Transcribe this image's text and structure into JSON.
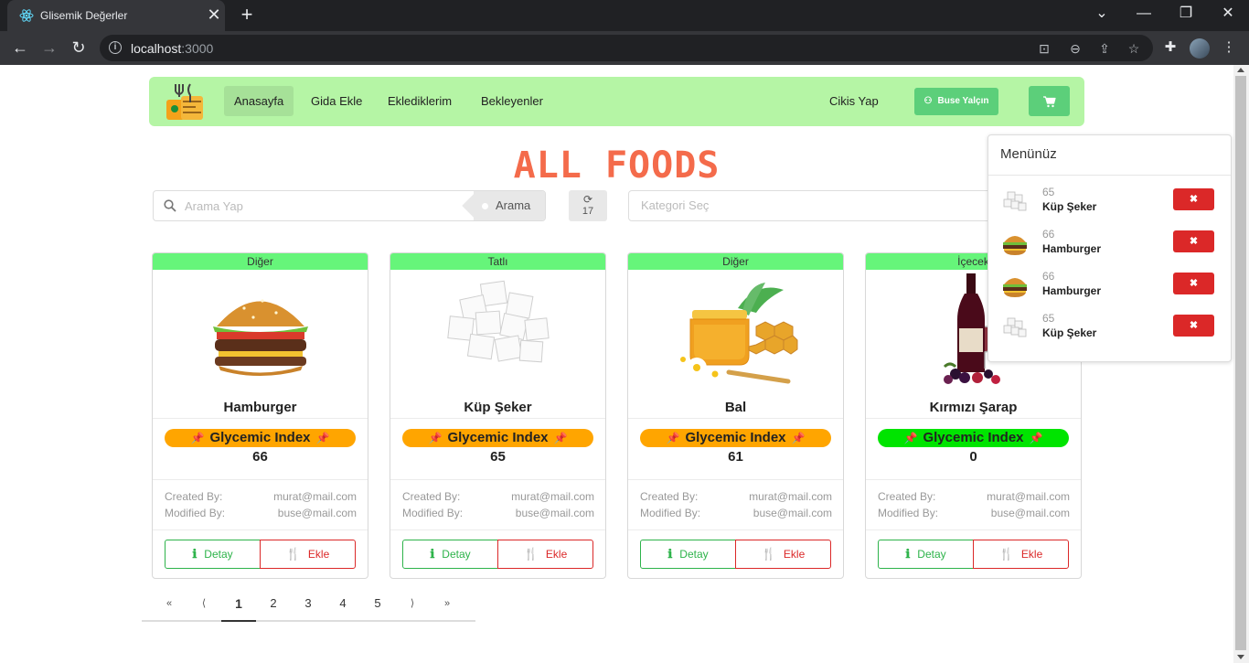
{
  "browser": {
    "tab_title": "Glisemik Değerler",
    "tab_close": "✕",
    "new_tab": "+",
    "url_host": "localhost",
    "url_port": ":3000"
  },
  "navbar": {
    "items": [
      {
        "label": "Anasayfa",
        "active": true
      },
      {
        "label": "Gida Ekle"
      },
      {
        "label": "Ekledik­lerim"
      },
      {
        "label": "Bekleyenler"
      }
    ],
    "logout_label": "Cikis Yap",
    "user_label": "Buse Yalçın"
  },
  "page": {
    "title": "ALL FOODS",
    "search_placeholder": "Arama Yap",
    "search_button": "Arama",
    "count": "17",
    "category_placeholder": "Kategori Seç"
  },
  "cards": [
    {
      "category": "Diğer",
      "name": "Hamburger",
      "gi_label": "Glycemic Index",
      "gi_value": "66",
      "gi_color": "#ffa500",
      "created_label": "Created By:",
      "created_by": "murat@mail.com",
      "modified_label": "Modified By:",
      "modified_by": "buse@mail.com",
      "detail_label": "Detay",
      "add_label": "Ekle",
      "image": "hamburger"
    },
    {
      "category": "Tatlı",
      "name": "Küp Şeker",
      "gi_label": "Glycemic Index",
      "gi_value": "65",
      "gi_color": "#ffa500",
      "created_label": "Created By:",
      "created_by": "murat@mail.com",
      "modified_label": "Modified By:",
      "modified_by": "buse@mail.com",
      "detail_label": "Detay",
      "add_label": "Ekle",
      "image": "sugar-cubes"
    },
    {
      "category": "Diğer",
      "name": "Bal",
      "gi_label": "Glycemic Index",
      "gi_value": "61",
      "gi_color": "#ffa500",
      "created_label": "Created By:",
      "created_by": "murat@mail.com",
      "modified_label": "Modified By:",
      "modified_by": "buse@mail.com",
      "detail_label": "Detay",
      "add_label": "Ekle",
      "image": "honey"
    },
    {
      "category": "İçecek",
      "name": "Kırmızı Şarap",
      "gi_label": "Glycemic Index",
      "gi_value": "0",
      "gi_color": "#00e400",
      "created_label": "Created By:",
      "created_by": "murat@mail.com",
      "modified_label": "Modified By:",
      "modified_by": "buse@mail.com",
      "detail_label": "Detay",
      "add_label": "Ekle",
      "image": "red-wine"
    }
  ],
  "pagination": {
    "first": "«",
    "prev": "⟨",
    "pages": [
      "1",
      "2",
      "3",
      "4",
      "5"
    ],
    "active_page": "1",
    "next": "⟩",
    "last": "»"
  },
  "menu": {
    "title": "Menünüz",
    "items": [
      {
        "gi": "65",
        "name": "Küp Şeker",
        "image": "sugar-cubes"
      },
      {
        "gi": "66",
        "name": "Hamburger",
        "image": "hamburger"
      },
      {
        "gi": "66",
        "name": "Hamburger",
        "image": "hamburger"
      },
      {
        "gi": "65",
        "name": "Küp Şeker",
        "image": "sugar-cubes"
      }
    ],
    "delete_label": "✖"
  },
  "colors": {
    "navbar_bg": "#b5f5a5",
    "accent_green": "#5ccf7a",
    "category_bar": "#66f57a",
    "title": "#f46b4b",
    "danger": "#db2828",
    "success": "#2db34a"
  }
}
